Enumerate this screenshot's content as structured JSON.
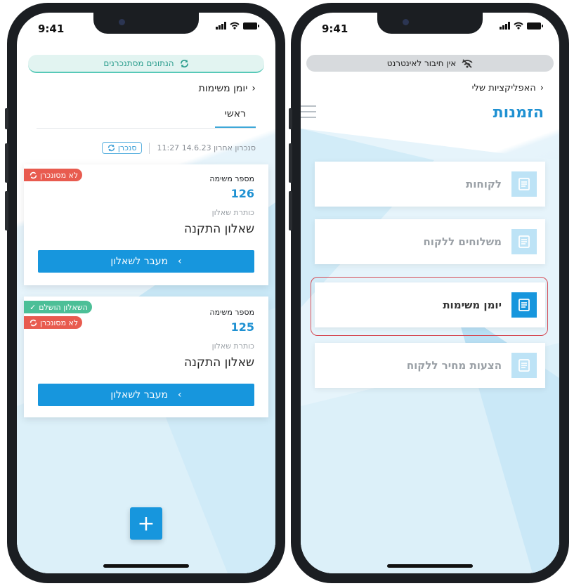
{
  "status_bar": {
    "time": "9:41"
  },
  "left_screen": {
    "sync_banner": "הנתונים מסתנכרנים",
    "breadcrumb": "יומן משימות",
    "tab_main": "ראשי",
    "last_sync": "סנכרון אחרון 14.6.23 11:27",
    "sync_button": "סנכרן",
    "cards": [
      {
        "badges": [
          {
            "text": "לא מסונכרן",
            "color": "#e85b4f"
          }
        ],
        "task_label": "מספר משימה",
        "task_number": "126",
        "questionnaire_label": "כותרת שאלון",
        "questionnaire_title": "שאלון התקנה",
        "button_label": "מעבר לשאלון"
      },
      {
        "badges": [
          {
            "text": "השאלון הושלם",
            "color": "#4cbf97"
          },
          {
            "text": "לא מסונכרן",
            "color": "#e85b4f"
          }
        ],
        "task_label": "מספר משימה",
        "task_number": "125",
        "questionnaire_label": "כותרת שאלון",
        "questionnaire_title": "שאלון התקנה",
        "button_label": "מעבר לשאלון"
      }
    ],
    "fab_label": "+"
  },
  "right_screen": {
    "offline_banner": "אין חיבור לאינטרנט",
    "breadcrumb": "האפליקציות שלי",
    "page_title": "הזמנות",
    "apps": [
      {
        "label": "לקוחות",
        "active": false
      },
      {
        "label": "משלוחים ללקוח",
        "active": false
      },
      {
        "label": "יומן משימות",
        "active": true
      },
      {
        "label": "הצעות מחיר ללקוח",
        "active": false
      }
    ]
  },
  "colors": {
    "accent": "#1796dd",
    "badge_red": "#e85b4f",
    "badge_green": "#4cbf97",
    "highlight": "#d54a54"
  }
}
